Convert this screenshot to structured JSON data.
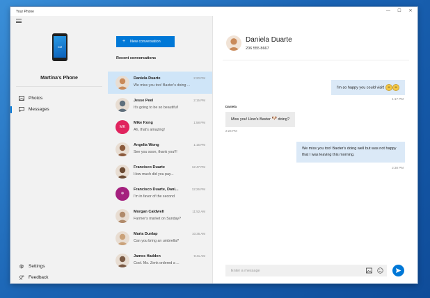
{
  "window": {
    "title": "Your Phone",
    "controls": {
      "minimize": "—",
      "maximize": "☐",
      "close": "✕"
    }
  },
  "sidebar": {
    "phone_name": "Martina's Phone",
    "phone_screen_text": "GM",
    "items": [
      {
        "label": "Photos",
        "icon": "photos-icon"
      },
      {
        "label": "Messages",
        "icon": "messages-icon",
        "selected": true
      }
    ],
    "bottom_items": [
      {
        "label": "Settings",
        "icon": "gear-icon"
      },
      {
        "label": "Feedback",
        "icon": "feedback-icon"
      }
    ]
  },
  "conversations": {
    "new_button": "New conversation",
    "recent_header": "Recent conversations",
    "items": [
      {
        "name": "Daniela Duarte",
        "time": "2:20 PM",
        "preview": "We miss you too! Baxter's doing ...",
        "avatar_color": "#c98a5a",
        "active": true
      },
      {
        "name": "Jesse Peel",
        "time": "2:15 PM",
        "preview": "It's going to be so beautiful!",
        "avatar_color": "#5f6f7c"
      },
      {
        "name": "Mike Kong",
        "time": "1:58 PM",
        "preview": "Ah, that's amazing!",
        "avatar_color": "#e0245e",
        "initials": "MK"
      },
      {
        "name": "Angelia Wong",
        "time": "1:15 PM",
        "preview": "See you soon, thank you!!!",
        "avatar_color": "#8b5a3c"
      },
      {
        "name": "Francisco Duarte",
        "time": "12:47 PM",
        "preview": "How much did you pay...",
        "avatar_color": "#6b4a32"
      },
      {
        "name": "Francisco Duarte, Dani...",
        "time": "12:26 PM",
        "preview": "I'm in favor of the second",
        "avatar_color": "#a4207e",
        "initials": "✲"
      },
      {
        "name": "Morgan Caldwell",
        "time": "11:52 AM",
        "preview": "Farmer's market on Sunday?",
        "avatar_color": "#b08a6a"
      },
      {
        "name": "Maria Dunlap",
        "time": "10:35 AM",
        "preview": "Can you bring an umbrella?",
        "avatar_color": "#caa27a"
      },
      {
        "name": "James Hadden",
        "time": "9:41 AM",
        "preview": "Cool. Ms. Zenk ordered a ...",
        "avatar_color": "#7a5a44"
      }
    ]
  },
  "chat": {
    "contact_name": "Daniela Duarte",
    "contact_phone": "206 555 8667",
    "avatar_color": "#c98a5a",
    "messages": [
      {
        "dir": "out",
        "text": "I'm so happy you could visit!",
        "time": "1:17 PM"
      },
      {
        "dir": "in",
        "sender": "Daniela",
        "text_before": "Miss you! How's Baxter",
        "text_after": "doing?",
        "time": "2:24 PM"
      },
      {
        "dir": "out",
        "text": "We miss you too! Baxter's doing well but was not happy that I was leaving this morning.",
        "time": "2:30 PM"
      }
    ],
    "compose_placeholder": "Enter a message"
  }
}
